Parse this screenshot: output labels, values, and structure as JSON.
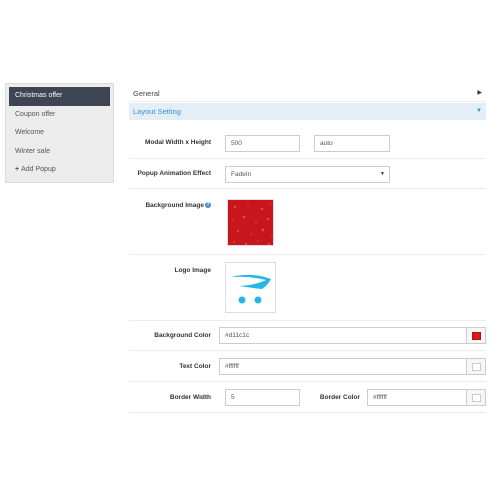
{
  "sidebar": {
    "items": [
      {
        "label": "Christmas offer",
        "active": true
      },
      {
        "label": "Coupon offer",
        "active": false
      },
      {
        "label": "Welcome",
        "active": false
      },
      {
        "label": "Winter sale",
        "active": false
      }
    ],
    "add_label": "Add Popup",
    "add_icon": "plus-icon"
  },
  "panels": {
    "general": {
      "title": "General",
      "icon": "caret-right-icon"
    },
    "layout": {
      "title": "Layout Setting",
      "icon": "caret-down-icon"
    }
  },
  "form": {
    "modal_size": {
      "label": "Modal Width x Height",
      "width": "500",
      "height": "auto"
    },
    "animation": {
      "label": "Popup Animation Effect",
      "value": "FadeIn"
    },
    "background_image": {
      "label": "Background Image",
      "help_icon": "help-icon"
    },
    "logo_image": {
      "label": "Logo Image"
    },
    "background_color": {
      "label": "Background Color",
      "value": "#d11c1c",
      "swatch": "#d11c1c"
    },
    "text_color": {
      "label": "Text Color",
      "value": "#ffffff",
      "swatch": "#ffffff"
    },
    "border_width": {
      "label": "Border Width",
      "value": "5"
    },
    "border_color": {
      "label": "Border Color",
      "value": "#ffffff",
      "swatch": "#ffffff"
    }
  },
  "colors": {
    "sidebar_active": "#3d4552",
    "accent": "#3a8fd6",
    "preview_red": "#c8161c",
    "logo_blue": "#29b6e6"
  }
}
